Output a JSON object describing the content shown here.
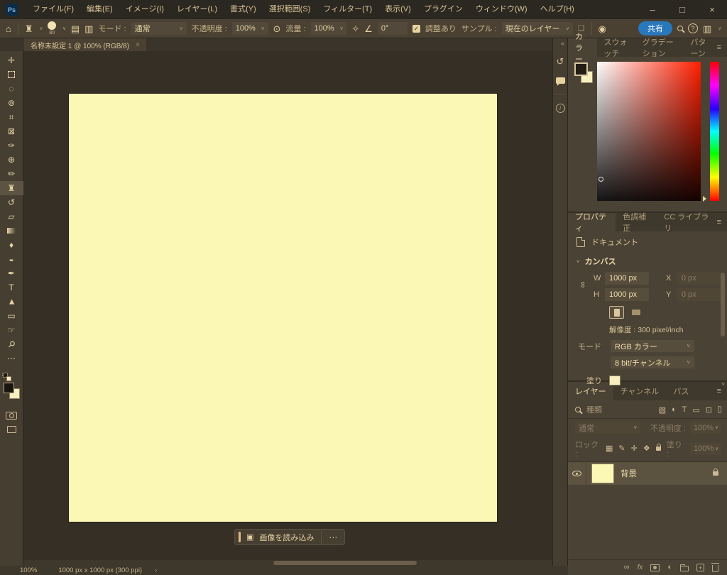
{
  "app": {
    "logo_text": "Ps"
  },
  "titlebar": {
    "menus": [
      "ファイル(F)",
      "編集(E)",
      "イメージ(I)",
      "レイヤー(L)",
      "書式(Y)",
      "選択範囲(S)",
      "フィルター(T)",
      "表示(V)",
      "プラグイン",
      "ウィンドウ(W)",
      "ヘルプ(H)"
    ],
    "minimize": "–",
    "maximize": "□",
    "close": "×"
  },
  "options_bar": {
    "brush_size": "80",
    "mode_label": "モード :",
    "mode_value": "通常",
    "opacity_label": "不透明度 :",
    "opacity_value": "100%",
    "flow_label": "流量 :",
    "flow_value": "100%",
    "angle_value": "0°",
    "aligned_label": "調整あり",
    "sample_label": "サンプル :",
    "sample_value": "現在のレイヤー",
    "share_label": "共有",
    "help_glyph": "?"
  },
  "document_tab": {
    "title": "名称未設定 1 @ 100% (RGB/8)",
    "close_glyph": "×"
  },
  "tools": [
    {
      "name": "move-tool",
      "glyph": "✛"
    },
    {
      "name": "marquee-tool",
      "glyph": ""
    },
    {
      "name": "lasso-tool",
      "glyph": "◌"
    },
    {
      "name": "object-selection-tool",
      "glyph": "⊚"
    },
    {
      "name": "crop-tool",
      "glyph": "⌗"
    },
    {
      "name": "frame-tool",
      "glyph": "⊠"
    },
    {
      "name": "eyedropper-tool",
      "glyph": "✑"
    },
    {
      "name": "healing-brush-tool",
      "glyph": "⊕"
    },
    {
      "name": "brush-tool",
      "glyph": "✏"
    },
    {
      "name": "clone-stamp-tool",
      "glyph": "♜"
    },
    {
      "name": "history-brush-tool",
      "glyph": "↺"
    },
    {
      "name": "eraser-tool",
      "glyph": "▱"
    },
    {
      "name": "gradient-tool",
      "glyph": ""
    },
    {
      "name": "blur-tool",
      "glyph": "♦"
    },
    {
      "name": "dodge-tool",
      "glyph": "◒"
    },
    {
      "name": "pen-tool",
      "glyph": "✒"
    },
    {
      "name": "type-tool",
      "glyph": "T"
    },
    {
      "name": "path-selection-tool",
      "glyph": "►"
    },
    {
      "name": "shape-tool",
      "glyph": "▭"
    },
    {
      "name": "hand-tool",
      "glyph": "☞"
    },
    {
      "name": "zoom-tool",
      "glyph": "⚲"
    },
    {
      "name": "edit-toolbar",
      "glyph": "⋯"
    }
  ],
  "task_bar": {
    "load_image": "画像を読み込み",
    "more": "⋯",
    "icon_glyph": "▣"
  },
  "side_strip": {
    "collapse": "«",
    "history_glyph": "↺",
    "info_glyph": "i"
  },
  "color_panel": {
    "tabs": [
      "カラー",
      "スウォッチ",
      "グラデーション",
      "パターン"
    ]
  },
  "properties_panel": {
    "tabs": [
      "プロパティ",
      "色調補正",
      "CC ライブラリ"
    ],
    "document_label": "ドキュメント",
    "canvas_section": "カンバス",
    "w_label": "W",
    "w_value": "1000 px",
    "x_label": "X",
    "x_value": "0 px",
    "h_label": "H",
    "h_value": "1000 px",
    "y_label": "Y",
    "y_value": "0 px",
    "resolution": "解像度 : 300 pixel/inch",
    "mode_label": "モード",
    "mode_value": "RGB カラー",
    "depth_value": "8 bit/チャンネル",
    "fill_label": "塗り"
  },
  "layers_panel": {
    "tabs": [
      "レイヤー",
      "チャンネル",
      "パス"
    ],
    "filter_label": "種類",
    "blend_mode": "通常",
    "opacity_label": "不透明度 :",
    "opacity_value": "100%",
    "lock_label": "ロック :",
    "fill_label": "塗り :",
    "fill_value": "100%",
    "layer_name": "背景"
  },
  "status_bar": {
    "zoom": "100%",
    "dimensions": "1000 px x 1000 px (300 ppi)",
    "chevron": "›"
  },
  "icons": {
    "home": "⌂",
    "caret": "˅",
    "menu": "≡",
    "stamp": "♜",
    "brush_settings": "▤",
    "brush_panel": "▥",
    "pressure_opacity": "⊙",
    "airbrush": "✧",
    "angle": "∠",
    "sample_all_layers": "❏",
    "pressure_size": "◉",
    "check": "✓",
    "fx": "fx",
    "adjustment": "◐",
    "chain": "∞",
    "filter_image": "▧",
    "filter_adjust": "◐",
    "filter_type": "T",
    "filter_shape": "▭",
    "filter_smart": "⊡",
    "lock_transparency": "▦",
    "lock_pixels": "✎",
    "lock_position": "✛",
    "lock_artboard": "❖",
    "swap": "⇄",
    "chevron_down": "˅"
  },
  "colors": {
    "canvas": "#fbf7b5",
    "accent_blue": "#2878bb",
    "foreground_swatch": "#181410",
    "background_swatch": "#f7efc0",
    "panel_bg": "#4a4234",
    "pasteboard": "#362f26"
  }
}
